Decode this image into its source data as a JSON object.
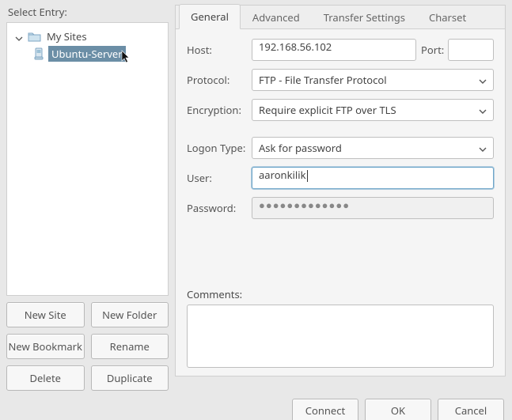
{
  "leftPane": {
    "selectLabel": "Select Entry:",
    "rootLabel": "My Sites",
    "selectedEntry": "Ubuntu-Server"
  },
  "leftButtons": {
    "newSite": "New Site",
    "newFolder": "New Folder",
    "newBookmark": "New Bookmark",
    "rename": "Rename",
    "delete": "Delete",
    "duplicate": "Duplicate"
  },
  "tabs": {
    "general": "General",
    "advanced": "Advanced",
    "transfer": "Transfer Settings",
    "charset": "Charset"
  },
  "form": {
    "hostLabel": "Host:",
    "hostValue": "192.168.56.102",
    "portLabel": "Port:",
    "portValue": "",
    "protocolLabel": "Protocol:",
    "protocolValue": "FTP - File Transfer Protocol",
    "encryptionLabel": "Encryption:",
    "encryptionValue": "Require explicit FTP over TLS",
    "logonTypeLabel": "Logon Type:",
    "logonTypeValue": "Ask for password",
    "userLabel": "User:",
    "userValue": "aaronkilik",
    "passwordLabel": "Password:",
    "passwordValue": "●●●●●●●●●●●●●",
    "commentsLabel": "Comments:"
  },
  "footer": {
    "connect": "Connect",
    "ok": "OK",
    "cancel": "Cancel"
  }
}
